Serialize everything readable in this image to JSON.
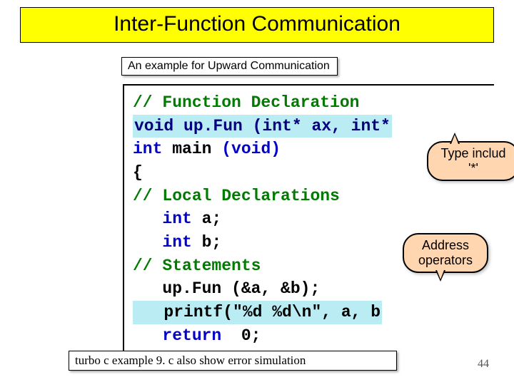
{
  "title": "Inter-Function Communication",
  "subtitle": "An example for Upward Communication",
  "code": {
    "l1": "// Function Declaration",
    "l2": "void up.Fun (int* ax, int*",
    "l3a": "int",
    "l3b": " main ",
    "l3c": "(void)",
    "l4": "{",
    "l5": "// Local Declarations",
    "l6a": "   int",
    "l6b": " a;",
    "l7a": "   int",
    "l7b": " b;",
    "l8": "// Statements",
    "l9": "   up.Fun (&a, &b);",
    "l10": "   printf(\"%d %d\\n\", a, b",
    "l11a": "   return",
    "l11b": "  0;"
  },
  "callouts": {
    "type_incl_1": "Type includ",
    "type_incl_2": "'*'",
    "addr_1": "Address",
    "addr_2": "operators"
  },
  "footer": "turbo c example 9. c also show error simulation",
  "page": "44"
}
